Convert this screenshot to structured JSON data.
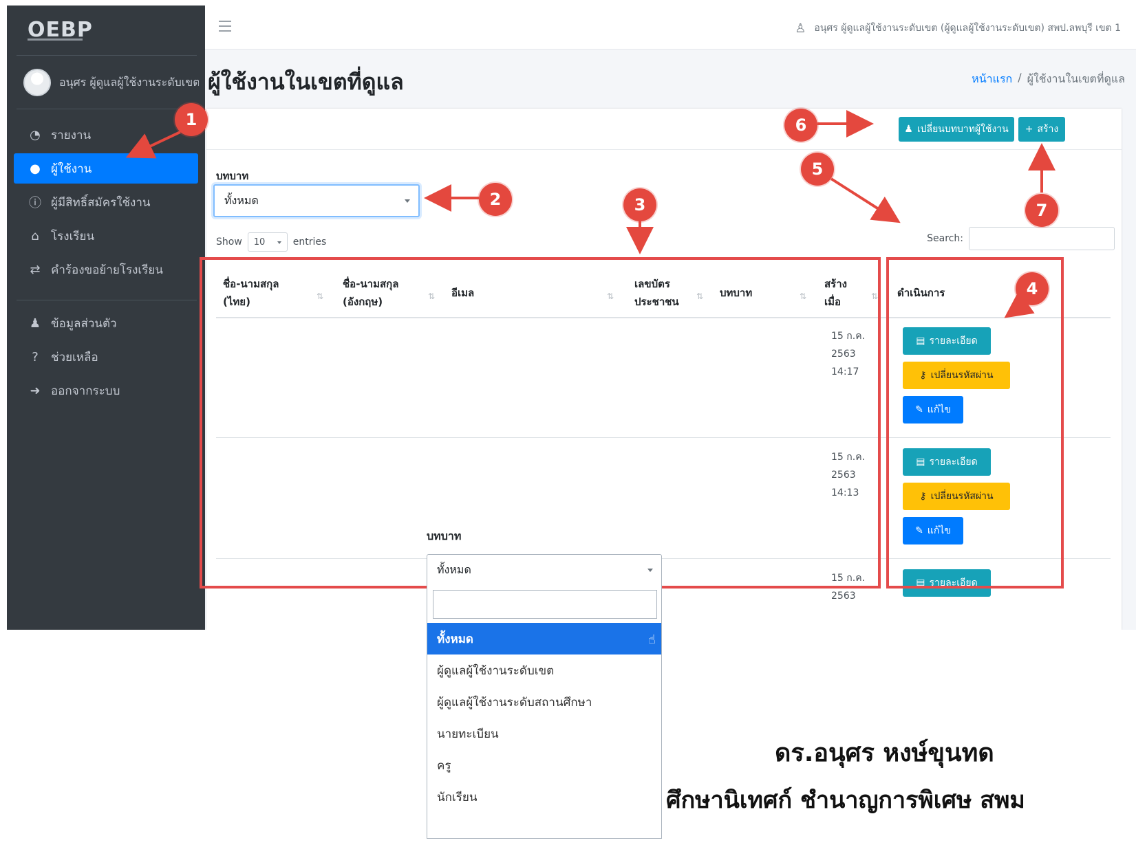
{
  "sidebar": {
    "brand": "OEBP",
    "user_name": "อนุศร ผู้ดูแลผู้ใช้งานระดับเขต",
    "nav": [
      {
        "label": "รายงาน",
        "icon": "dashboard-icon",
        "active": false
      },
      {
        "label": "ผู้ใช้งาน",
        "icon": "users-icon",
        "active": true
      },
      {
        "label": "ผู้มีสิทธิ์สมัครใช้งาน",
        "icon": "info-icon",
        "active": false
      },
      {
        "label": "โรงเรียน",
        "icon": "school-icon",
        "active": false
      },
      {
        "label": "คำร้องขอย้ายโรงเรียน",
        "icon": "transfer-icon",
        "active": false
      }
    ],
    "nav2": [
      {
        "label": "ข้อมูลส่วนตัว",
        "icon": "profile-icon"
      },
      {
        "label": "ช่วยเหลือ",
        "icon": "help-icon"
      },
      {
        "label": "ออกจากระบบ",
        "icon": "logout-icon"
      }
    ]
  },
  "topbar": {
    "user_text": "อนุศร ผู้ดูแลผู้ใช้งานระดับเขต (ผู้ดูแลผู้ใช้งานระดับเขต) สพป.ลพบุรี เขต 1"
  },
  "page": {
    "title": "ผู้ใช้งานในเขตที่ดูแล",
    "breadcrumb_home": "หน้าแรก",
    "breadcrumb_current": "ผู้ใช้งานในเขตที่ดูแล"
  },
  "toolbar": {
    "change_role_label": "เปลี่ยนบทบาทผู้ใช้งาน",
    "create_label": "สร้าง"
  },
  "filter": {
    "label": "บทบาท",
    "selected": "ทั้งหมด"
  },
  "table": {
    "show_label": "Show",
    "entries_value": "10",
    "entries_label": "entries",
    "search_label": "Search:",
    "columns": [
      "ชื่อ-นามสกุล (ไทย)",
      "ชื่อ-นามสกุล (อังกฤษ)",
      "อีเมล",
      "เลขบัตรประชาชน",
      "บทบาท",
      "สร้างเมื่อ",
      "ดำเนินการ"
    ],
    "rows": [
      {
        "created": [
          "15 ก.ค.",
          "2563",
          "14:17"
        ]
      },
      {
        "created": [
          "15 ก.ค.",
          "2563",
          "14:13"
        ]
      },
      {
        "created": [
          "15 ก.ค.",
          "2563"
        ]
      }
    ],
    "actions": {
      "detail": "รายละเอียด",
      "reset_password": "เปลี่ยนรหัสผ่าน",
      "edit": "แก้ไข"
    }
  },
  "markers": [
    "1",
    "2",
    "3",
    "4",
    "5",
    "6",
    "7"
  ],
  "dropdown": {
    "label": "บทบาท",
    "selected": "ทั้งหมด",
    "options": [
      "ทั้งหมด",
      "ผู้ดูแลผู้ใช้งานระดับเขต",
      "ผู้ดูแลผู้ใช้งานระดับสถานศึกษา",
      "นายทะเบียน",
      "ครู",
      "นักเรียน"
    ]
  },
  "signature": {
    "name": "ดร.อนุศร หงษ์ขุนทด",
    "position": "ศึกษานิเทศก์ ชำนาญการพิเศษ สพม"
  },
  "colors": {
    "sidebar_bg": "#343a40",
    "primary": "#007bff",
    "info": "#17a2b8",
    "warning": "#ffc107",
    "annotation": "#e4483e"
  }
}
